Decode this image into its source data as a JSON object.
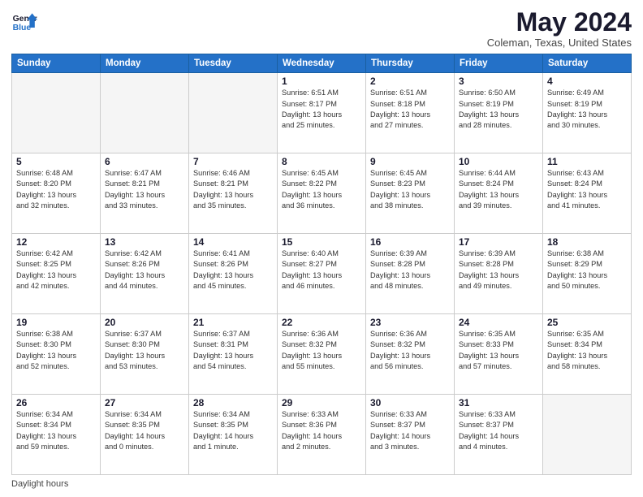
{
  "header": {
    "logo_line1": "General",
    "logo_line2": "Blue",
    "main_title": "May 2024",
    "subtitle": "Coleman, Texas, United States"
  },
  "days_of_week": [
    "Sunday",
    "Monday",
    "Tuesday",
    "Wednesday",
    "Thursday",
    "Friday",
    "Saturday"
  ],
  "weeks": [
    [
      {
        "day": "",
        "info": ""
      },
      {
        "day": "",
        "info": ""
      },
      {
        "day": "",
        "info": ""
      },
      {
        "day": "1",
        "info": "Sunrise: 6:51 AM\nSunset: 8:17 PM\nDaylight: 13 hours\nand 25 minutes."
      },
      {
        "day": "2",
        "info": "Sunrise: 6:51 AM\nSunset: 8:18 PM\nDaylight: 13 hours\nand 27 minutes."
      },
      {
        "day": "3",
        "info": "Sunrise: 6:50 AM\nSunset: 8:19 PM\nDaylight: 13 hours\nand 28 minutes."
      },
      {
        "day": "4",
        "info": "Sunrise: 6:49 AM\nSunset: 8:19 PM\nDaylight: 13 hours\nand 30 minutes."
      }
    ],
    [
      {
        "day": "5",
        "info": "Sunrise: 6:48 AM\nSunset: 8:20 PM\nDaylight: 13 hours\nand 32 minutes."
      },
      {
        "day": "6",
        "info": "Sunrise: 6:47 AM\nSunset: 8:21 PM\nDaylight: 13 hours\nand 33 minutes."
      },
      {
        "day": "7",
        "info": "Sunrise: 6:46 AM\nSunset: 8:21 PM\nDaylight: 13 hours\nand 35 minutes."
      },
      {
        "day": "8",
        "info": "Sunrise: 6:45 AM\nSunset: 8:22 PM\nDaylight: 13 hours\nand 36 minutes."
      },
      {
        "day": "9",
        "info": "Sunrise: 6:45 AM\nSunset: 8:23 PM\nDaylight: 13 hours\nand 38 minutes."
      },
      {
        "day": "10",
        "info": "Sunrise: 6:44 AM\nSunset: 8:24 PM\nDaylight: 13 hours\nand 39 minutes."
      },
      {
        "day": "11",
        "info": "Sunrise: 6:43 AM\nSunset: 8:24 PM\nDaylight: 13 hours\nand 41 minutes."
      }
    ],
    [
      {
        "day": "12",
        "info": "Sunrise: 6:42 AM\nSunset: 8:25 PM\nDaylight: 13 hours\nand 42 minutes."
      },
      {
        "day": "13",
        "info": "Sunrise: 6:42 AM\nSunset: 8:26 PM\nDaylight: 13 hours\nand 44 minutes."
      },
      {
        "day": "14",
        "info": "Sunrise: 6:41 AM\nSunset: 8:26 PM\nDaylight: 13 hours\nand 45 minutes."
      },
      {
        "day": "15",
        "info": "Sunrise: 6:40 AM\nSunset: 8:27 PM\nDaylight: 13 hours\nand 46 minutes."
      },
      {
        "day": "16",
        "info": "Sunrise: 6:39 AM\nSunset: 8:28 PM\nDaylight: 13 hours\nand 48 minutes."
      },
      {
        "day": "17",
        "info": "Sunrise: 6:39 AM\nSunset: 8:28 PM\nDaylight: 13 hours\nand 49 minutes."
      },
      {
        "day": "18",
        "info": "Sunrise: 6:38 AM\nSunset: 8:29 PM\nDaylight: 13 hours\nand 50 minutes."
      }
    ],
    [
      {
        "day": "19",
        "info": "Sunrise: 6:38 AM\nSunset: 8:30 PM\nDaylight: 13 hours\nand 52 minutes."
      },
      {
        "day": "20",
        "info": "Sunrise: 6:37 AM\nSunset: 8:30 PM\nDaylight: 13 hours\nand 53 minutes."
      },
      {
        "day": "21",
        "info": "Sunrise: 6:37 AM\nSunset: 8:31 PM\nDaylight: 13 hours\nand 54 minutes."
      },
      {
        "day": "22",
        "info": "Sunrise: 6:36 AM\nSunset: 8:32 PM\nDaylight: 13 hours\nand 55 minutes."
      },
      {
        "day": "23",
        "info": "Sunrise: 6:36 AM\nSunset: 8:32 PM\nDaylight: 13 hours\nand 56 minutes."
      },
      {
        "day": "24",
        "info": "Sunrise: 6:35 AM\nSunset: 8:33 PM\nDaylight: 13 hours\nand 57 minutes."
      },
      {
        "day": "25",
        "info": "Sunrise: 6:35 AM\nSunset: 8:34 PM\nDaylight: 13 hours\nand 58 minutes."
      }
    ],
    [
      {
        "day": "26",
        "info": "Sunrise: 6:34 AM\nSunset: 8:34 PM\nDaylight: 13 hours\nand 59 minutes."
      },
      {
        "day": "27",
        "info": "Sunrise: 6:34 AM\nSunset: 8:35 PM\nDaylight: 14 hours\nand 0 minutes."
      },
      {
        "day": "28",
        "info": "Sunrise: 6:34 AM\nSunset: 8:35 PM\nDaylight: 14 hours\nand 1 minute."
      },
      {
        "day": "29",
        "info": "Sunrise: 6:33 AM\nSunset: 8:36 PM\nDaylight: 14 hours\nand 2 minutes."
      },
      {
        "day": "30",
        "info": "Sunrise: 6:33 AM\nSunset: 8:37 PM\nDaylight: 14 hours\nand 3 minutes."
      },
      {
        "day": "31",
        "info": "Sunrise: 6:33 AM\nSunset: 8:37 PM\nDaylight: 14 hours\nand 4 minutes."
      },
      {
        "day": "",
        "info": ""
      }
    ]
  ],
  "footer": {
    "text": "Daylight hours"
  }
}
